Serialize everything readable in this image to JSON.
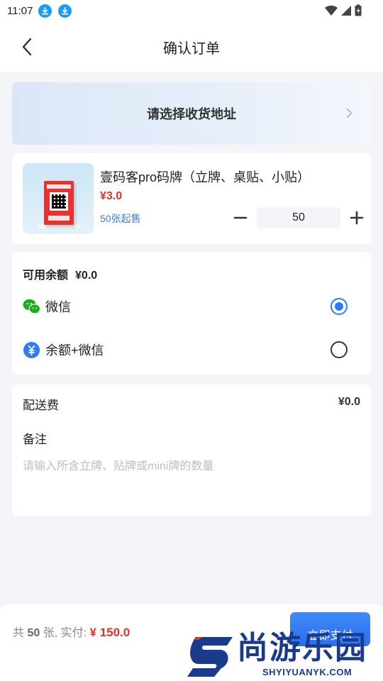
{
  "status_bar": {
    "time": "11:07"
  },
  "header": {
    "title": "确认订单"
  },
  "address": {
    "prompt": "请选择收货地址"
  },
  "product": {
    "name": "壹码客pro码牌（立牌、桌贴、小贴）",
    "price": "¥3.0",
    "min_order": "50张起售",
    "quantity": "50"
  },
  "payment": {
    "balance_label": "可用余额",
    "balance_value": "¥0.0",
    "options": [
      {
        "label": "微信",
        "icon": "wechat-icon",
        "selected": true
      },
      {
        "label": "余额+微信",
        "icon": "yuan-balance-icon",
        "selected": false
      }
    ]
  },
  "extras": {
    "delivery_label": "配送费",
    "delivery_value": "¥0.0",
    "remark_label": "备注",
    "remark_placeholder": "请输入所含立牌、贴牌或mini牌的数量"
  },
  "summary": {
    "prefix": "共",
    "count": "50",
    "suffix": "张, 实付:",
    "total": "¥ 150.0",
    "pay_button": "立即支付"
  },
  "watermark": {
    "text": "尚游乐园",
    "url": "SHYIYUANYK.COM"
  },
  "colors": {
    "accent": "#2f7cf6",
    "price": "#e0312d",
    "wechat": "#1aad19"
  }
}
